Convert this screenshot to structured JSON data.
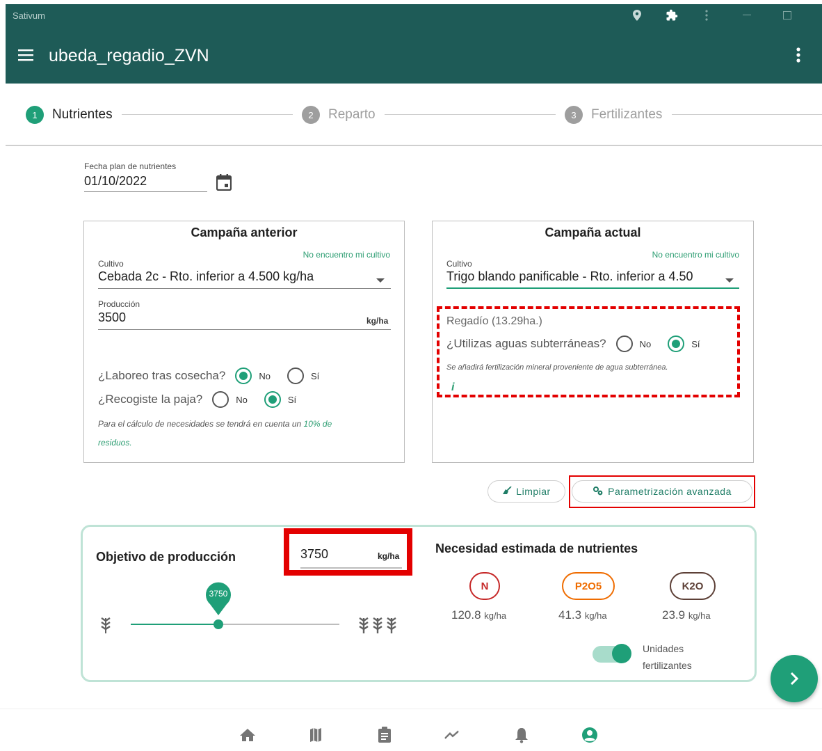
{
  "window": {
    "app_name": "Sativum"
  },
  "appbar": {
    "title": "ubeda_regadio_ZVN"
  },
  "stepper": {
    "steps": [
      {
        "num": "1",
        "label": "Nutrientes",
        "active": true
      },
      {
        "num": "2",
        "label": "Reparto",
        "active": false
      },
      {
        "num": "3",
        "label": "Fertilizantes",
        "active": false
      }
    ]
  },
  "date": {
    "label": "Fecha plan de nutrientes",
    "value": "01/10/2022"
  },
  "previous": {
    "title": "Campaña anterior",
    "not_found": "No encuentro mi cultivo",
    "crop_label": "Cultivo",
    "crop_value": "Cebada 2c - Rto. inferior a 4.500 kg/ha",
    "prod_label": "Producción",
    "prod_value": "3500",
    "prod_unit": "kg/ha",
    "q1": "¿Laboreo tras cosecha?",
    "q2": "¿Recogiste la paja?",
    "opt_no": "No",
    "opt_si": "Sí",
    "note_pre": "Para el cálculo de necesidades se tendrá en cuenta un ",
    "note_pct": "10% de",
    "note_post": "residuos."
  },
  "current": {
    "title": "Campaña actual",
    "not_found": "No encuentro mi cultivo",
    "crop_label": "Cultivo",
    "crop_value": "Trigo blando panificable - Rto. inferior a 4.50",
    "irrigation": "Regadío (13.29ha.)",
    "q_ground": "¿Utilizas aguas subterráneas?",
    "opt_no": "No",
    "opt_si": "Sí",
    "note": "Se añadirá fertilización mineral proveniente de agua subterránea.",
    "info": "i"
  },
  "actions": {
    "clear": "Limpiar",
    "advanced": "Parametrización avanzada"
  },
  "objective": {
    "title": "Objetivo de producción",
    "value": "3750",
    "unit": "kg/ha",
    "slider_value": "3750",
    "slider_fraction": 0.42
  },
  "needs": {
    "title": "Necesidad estimada de nutrientes",
    "unit": "kg/ha",
    "items": [
      {
        "name": "N",
        "value": "120.8",
        "color": "#c62828"
      },
      {
        "name": "P2O5",
        "value": "41.3",
        "color": "#ef6c00"
      },
      {
        "name": "K2O",
        "value": "23.9",
        "color": "#5d4037"
      }
    ],
    "toggle_label": "Unidades fertilizantes",
    "toggle_on": true
  },
  "colors": {
    "primary": "#1e5b57",
    "accent": "#1f9f78",
    "highlight": "#e30000"
  }
}
